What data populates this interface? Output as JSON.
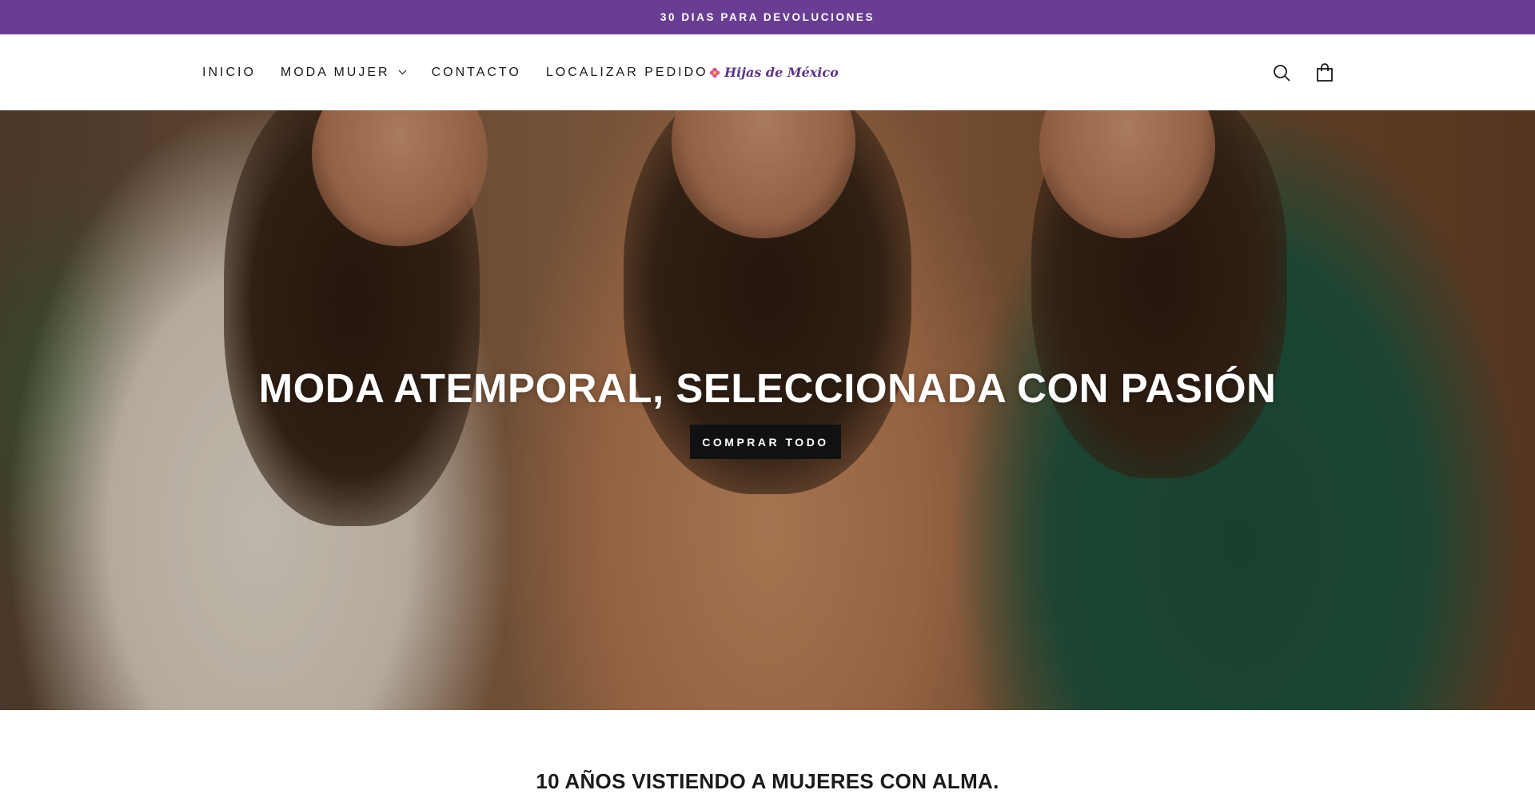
{
  "announcement": {
    "text": "30 DIAS PARA DEVOLUCIONES"
  },
  "header": {
    "nav": [
      {
        "label": "INICIO"
      },
      {
        "label": "MODA MUJER",
        "has_dropdown": true
      },
      {
        "label": "CONTACTO"
      },
      {
        "label": "LOCALIZAR PEDIDO"
      }
    ],
    "logo_text": "Hijas de México",
    "icons": [
      "search-icon",
      "cart-icon"
    ]
  },
  "hero": {
    "title": "MODA ATEMPORAL, SELECCIONADA CON PASIÓN",
    "button_label": "COMPRAR TODO"
  },
  "section": {
    "tagline": "10 AÑOS VISTIENDO A MUJERES CON ALMA."
  },
  "colors": {
    "announcement_bg": "#683d92",
    "logo": "#5d3587",
    "button_bg": "#111111"
  }
}
